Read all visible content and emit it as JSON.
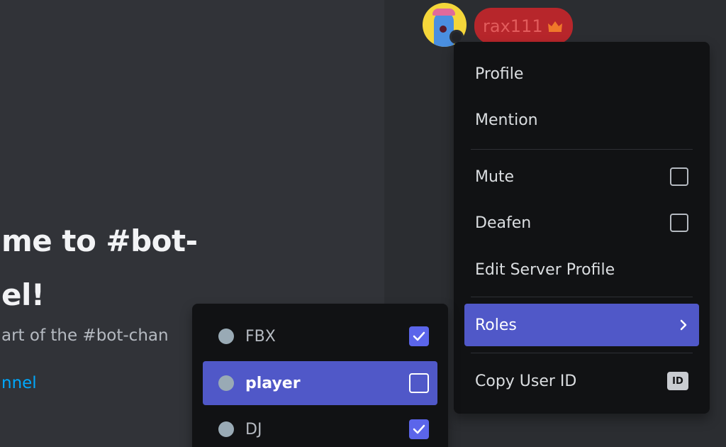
{
  "chat": {
    "welcome_line1": "me to #bot-",
    "welcome_line2": "el!",
    "subtitle": "art of the #bot-chan",
    "link": "nnel"
  },
  "member": {
    "username": "rax111",
    "username_color": "#e25c5c",
    "pill_color": "#b7262b",
    "crown_icon": "crown-icon"
  },
  "context_menu": {
    "items": [
      {
        "label": "Profile"
      },
      {
        "label": "Mention"
      },
      {
        "label": "Mute",
        "checked": false
      },
      {
        "label": "Deafen",
        "checked": false
      },
      {
        "label": "Edit Server Profile"
      },
      {
        "label": "Roles",
        "active": true,
        "icon": "chevron-right-icon"
      },
      {
        "label": "Copy User ID",
        "icon": "id-icon",
        "badge": "ID"
      }
    ]
  },
  "roles_menu": {
    "items": [
      {
        "label": "FBX",
        "checked": true
      },
      {
        "label": "player",
        "checked": false,
        "active": true
      },
      {
        "label": "DJ",
        "checked": true
      }
    ]
  },
  "colors": {
    "accent": "#5058c8",
    "checkbox_checked": "#5b65ea",
    "menu_bg": "#111214",
    "link": "#00a8fc"
  }
}
